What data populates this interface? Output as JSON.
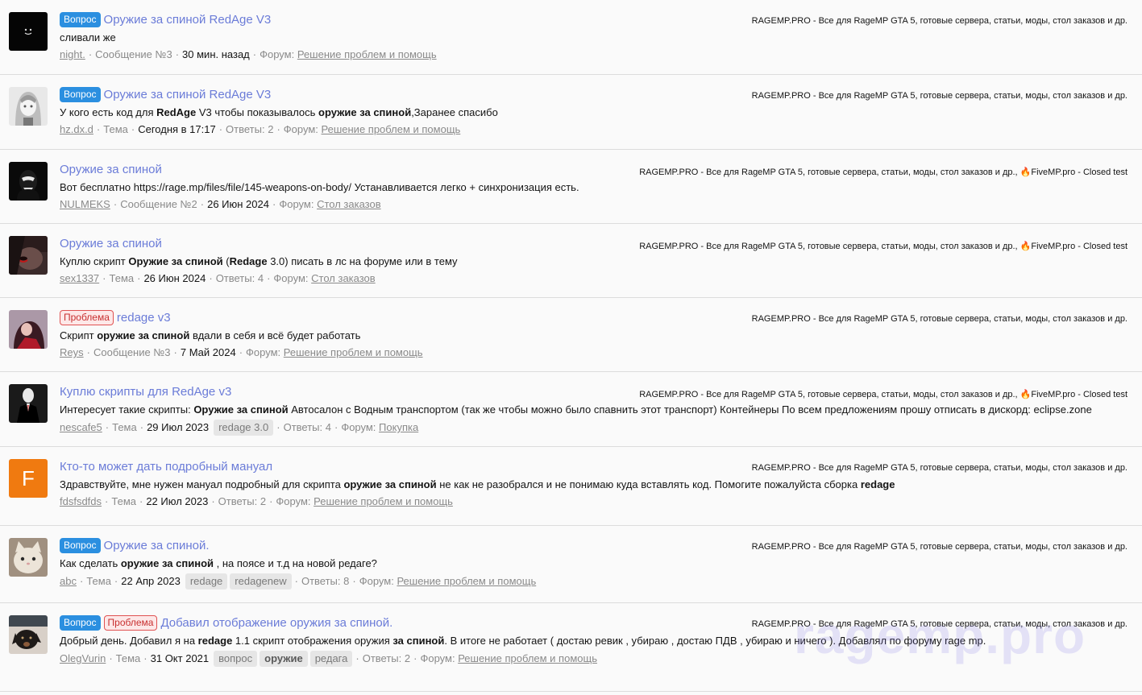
{
  "results": [
    {
      "avatar": "dark-smiley",
      "labels": [
        "Вопрос"
      ],
      "title": "Оружие за спиной RedAge V3",
      "origin": "RAGEMP.PRO - Все для RageMP GTA 5, готовые сервера, статьи, моды, стол заказов и др.",
      "snippet": "сливали же",
      "user": "night.",
      "kind": "Сообщение №3",
      "date": "30 мин. назад",
      "replies": "",
      "tags": [],
      "forum_prefix": "Форум:",
      "forum": "Решение проблем и помощь"
    },
    {
      "avatar": "anime-girl",
      "labels": [
        "Вопрос"
      ],
      "title": "Оружие за спиной RedAge V3",
      "origin": "RAGEMP.PRO - Все для RageMP GTA 5, готовые сервера, статьи, моды, стол заказов и др.",
      "snippet_parts": [
        [
          "У кого есть код для ",
          false
        ],
        [
          "RedAge",
          true
        ],
        [
          " V3 чтобы показывалось ",
          false
        ],
        [
          "оружие за спиной",
          true
        ],
        [
          ",Заранее спасибо",
          false
        ]
      ],
      "user": "hz.dx.d",
      "kind": "Тема",
      "date": "Сегодня в 17:17",
      "replies": "Ответы: 2",
      "tags": [],
      "forum_prefix": "Форум:",
      "forum": "Решение проблем и помощь"
    },
    {
      "avatar": "dark-mask",
      "labels": [],
      "title": "Оружие за спиной",
      "origin": "RAGEMP.PRO - Все для RageMP GTA 5, готовые сервера, статьи, моды, стол заказов и др.,",
      "origin_extra": "FiveMP.pro - Closed test",
      "snippet": "Вот бесплатно https://rage.mp/files/file/145-weapons-on-body/ Устанавливается легко + синхронизация есть.",
      "user": "NULMEKS",
      "kind": "Сообщение №2",
      "date": "26 Июн 2024",
      "replies": "",
      "tags": [],
      "forum_prefix": "Форум:",
      "forum": "Стол заказов"
    },
    {
      "avatar": "dark-face",
      "labels": [],
      "title": "Оружие за спиной",
      "origin": "RAGEMP.PRO - Все для RageMP GTA 5, готовые сервера, статьи, моды, стол заказов и др.,",
      "origin_extra": "FiveMP.pro - Closed test",
      "snippet_parts": [
        [
          "Куплю скрипт ",
          false
        ],
        [
          "Оружие за спиной",
          true
        ],
        [
          " (",
          false
        ],
        [
          "Redage",
          true
        ],
        [
          " 3.0) писать в лс на форуме или в тему",
          false
        ]
      ],
      "user": "sex1337",
      "kind": "Тема",
      "date": "26 Июн 2024",
      "replies": "Ответы: 4",
      "tags": [],
      "forum_prefix": "Форум:",
      "forum": "Стол заказов"
    },
    {
      "avatar": "red-girl",
      "labels": [
        "Проблема"
      ],
      "title": "redage v3",
      "origin": "RAGEMP.PRO - Все для RageMP GTA 5, готовые сервера, статьи, моды, стол заказов и др.",
      "snippet_parts": [
        [
          "Скрипт ",
          false
        ],
        [
          "оружие за спиной",
          true
        ],
        [
          " вдали в себя и всё будет работать",
          false
        ]
      ],
      "user": "Reys",
      "kind": "Сообщение №3",
      "date": "7 Май 2024",
      "replies": "",
      "tags": [],
      "forum_prefix": "Форум:",
      "forum": "Решение проблем и помощь"
    },
    {
      "avatar": "slender",
      "labels": [],
      "title_parts": [
        [
          "Куплю скрипты для ",
          false
        ],
        [
          "RedAge",
          true
        ],
        [
          " v3",
          false
        ]
      ],
      "origin": "RAGEMP.PRO - Все для RageMP GTA 5, готовые сервера, статьи, моды, стол заказов и др.,",
      "origin_extra": "FiveMP.pro - Closed test",
      "snippet_parts": [
        [
          "Интересует такие скрипты: ",
          false
        ],
        [
          "Оружие за спиной",
          true
        ],
        [
          " Автосалон с Водным транспортом (так же чтобы можно было спавнить этот транспорт) Контейнеры По всем предложениям прошу отписать в дискорд: eclipse.zone",
          false
        ]
      ],
      "user": "nescafe5",
      "kind": "Тема",
      "date": "29 Июл 2023",
      "replies": "Ответы: 4",
      "tags": [
        "redage 3.0"
      ],
      "forum_prefix": "Форум:",
      "forum": "Покупка"
    },
    {
      "avatar": "letter-f",
      "avatar_letter": "F",
      "avatar_color": "#f07a10",
      "labels": [],
      "title": "Кто-то может дать подробный мануал",
      "origin": "RAGEMP.PRO - Все для RageMP GTA 5, готовые сервера, статьи, моды, стол заказов и др.",
      "snippet_parts": [
        [
          "Здравствуйте, мне нужен мануал подробный для скрипта ",
          false
        ],
        [
          "оружие за спиной",
          true
        ],
        [
          " не как не разобрался и не понимаю куда вставлять код. Помогите пожалуйста сборка ",
          false
        ],
        [
          "redage",
          true
        ]
      ],
      "user": "fdsfsdfds",
      "kind": "Тема",
      "date": "22 Июл 2023",
      "replies": "Ответы: 2",
      "tags": [],
      "forum_prefix": "Форум:",
      "forum": "Решение проблем и помощь"
    },
    {
      "avatar": "cat",
      "labels": [
        "Вопрос"
      ],
      "title": "Оружие за спиной.",
      "origin": "RAGEMP.PRO - Все для RageMP GTA 5, готовые сервера, статьи, моды, стол заказов и др.",
      "snippet_parts": [
        [
          "Как сделать ",
          false
        ],
        [
          "оружие за спиной",
          true
        ],
        [
          " , на поясе и т.д на новой редаге?",
          false
        ]
      ],
      "user": "abc",
      "kind": "Тема",
      "date": "22 Апр 2023",
      "replies": "Ответы: 8",
      "tags": [
        "redage",
        "redagenew"
      ],
      "forum_prefix": "Форум:",
      "forum": "Решение проблем и помощь"
    },
    {
      "avatar": "dog",
      "labels": [
        "Вопрос",
        "Проблема"
      ],
      "title_parts": [
        [
          "Добавил отображение оружия ",
          false
        ],
        [
          "за спиной",
          true
        ],
        [
          ".",
          false
        ]
      ],
      "origin": "RAGEMP.PRO - Все для RageMP GTA 5, готовые сервера, статьи, моды, стол заказов и др.",
      "snippet_parts": [
        [
          "Добрый день. Добавил я на ",
          false
        ],
        [
          "redage",
          true
        ],
        [
          " 1.1 скрипт отображения оружия ",
          false
        ],
        [
          "за спиной",
          true
        ],
        [
          ". В итоге не работает ( достаю ревик , убираю , достаю ПДВ , убираю и ничего ). Добавлял по форуму rage mp.",
          false
        ]
      ],
      "user": "OlegVurin",
      "kind": "Тема",
      "date": "31 Окт 2021",
      "replies": "Ответы: 2",
      "tags": [
        "вопрос",
        "оружие",
        "редага"
      ],
      "tags_bold": [
        false,
        true,
        false
      ],
      "forum_prefix": "Форум:",
      "forum": "Решение проблем и помощь"
    }
  ],
  "watermark": "ragemp.pro",
  "colors": {
    "link": "#6b7cd8",
    "label_question": "#2b8fe0",
    "label_problem": "#e05252",
    "muted": "#8a8a8a"
  }
}
